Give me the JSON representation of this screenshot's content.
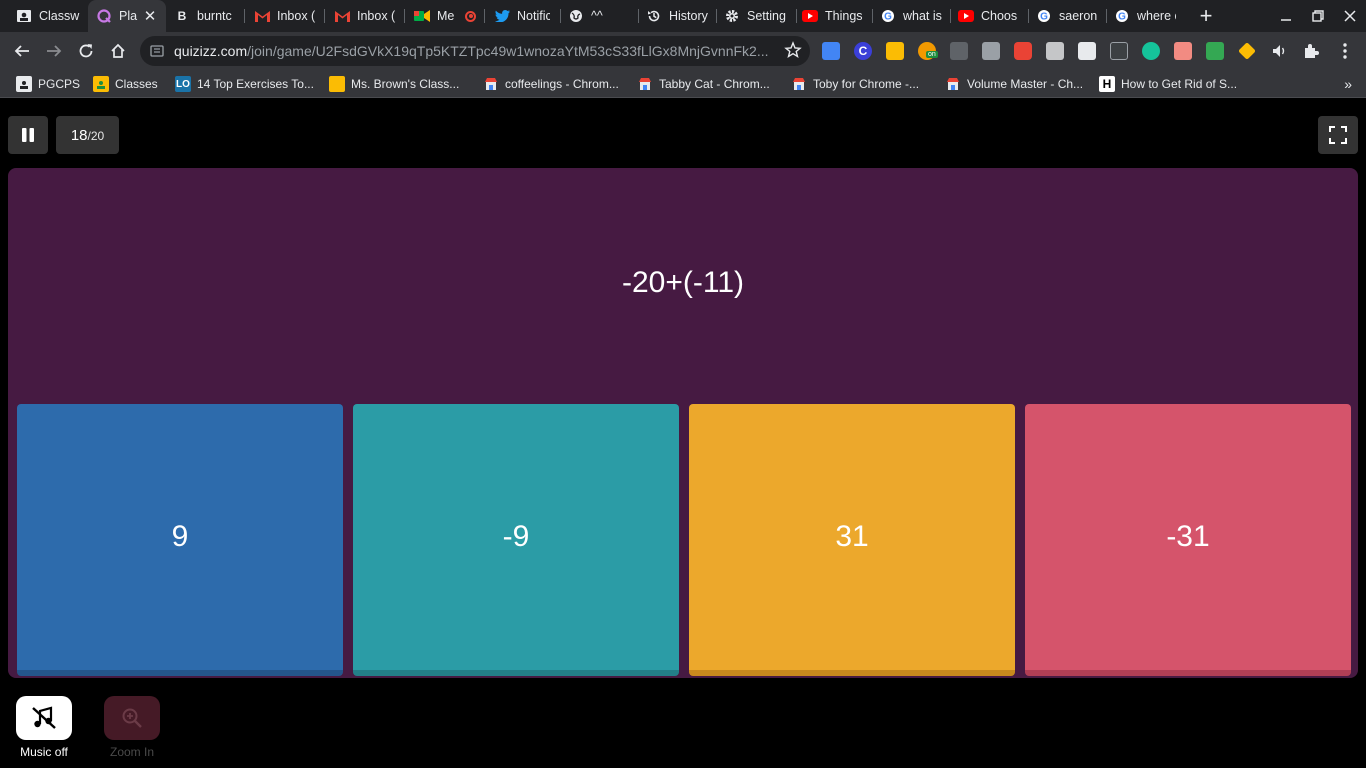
{
  "browser": {
    "tabs": [
      {
        "title": "Classw",
        "icon": "classroom-icon",
        "active": false
      },
      {
        "title": "Pla",
        "icon": "quizizz-icon",
        "active": true
      },
      {
        "title": "burntc",
        "icon": "bold-b-icon",
        "active": false
      },
      {
        "title": "Inbox (",
        "icon": "gmail-icon",
        "active": false
      },
      {
        "title": "Inbox (",
        "icon": "gmail-icon",
        "active": false
      },
      {
        "title": "Me",
        "icon": "meet-icon",
        "active": false
      },
      {
        "title": "Notific",
        "icon": "twitter-icon",
        "active": false
      },
      {
        "title": "^^",
        "icon": "globe-icon",
        "active": false
      },
      {
        "title": "History",
        "icon": "history-icon",
        "active": false
      },
      {
        "title": "Setting",
        "icon": "gear-icon",
        "active": false
      },
      {
        "title": "Things",
        "icon": "youtube-icon",
        "active": false
      },
      {
        "title": "what is",
        "icon": "google-icon",
        "active": false
      },
      {
        "title": "Choos",
        "icon": "youtube-icon",
        "active": false
      },
      {
        "title": "saeron",
        "icon": "google-icon",
        "active": false
      },
      {
        "title": "where c",
        "icon": "google-icon",
        "active": false
      }
    ],
    "url_host": "quizizz.com",
    "url_path": "/join/game/U2FsdGVkX19qTp5KTZTpc49w1wnozaYtM53cS33fLlGx8MnjGvnnFk2...",
    "bookmarks": [
      {
        "label": "PGCPS",
        "icon": "classroom-icon"
      },
      {
        "label": "Classes",
        "icon": "classroom-icon"
      },
      {
        "label": "14 Top Exercises To...",
        "icon": "lo-icon"
      },
      {
        "label": "Ms. Brown's Class...",
        "icon": "folder-icon"
      },
      {
        "label": "coffeelings - Chrom...",
        "icon": "store-icon"
      },
      {
        "label": "Tabby Cat - Chrom...",
        "icon": "store-icon"
      },
      {
        "label": "Toby for Chrome -...",
        "icon": "store-icon"
      },
      {
        "label": "Volume Master - Ch...",
        "icon": "store-icon"
      },
      {
        "label": "How to Get Rid of S...",
        "icon": "h-icon"
      }
    ]
  },
  "quiz": {
    "current": "18",
    "total": "/20",
    "question": "-20+(-11)",
    "options": [
      "9",
      "-9",
      "31",
      "-31"
    ],
    "music_label": "Music off",
    "zoom_label": "Zoom In"
  },
  "colors": {
    "panel": "#461a42",
    "option_blue": "#2d6bac",
    "option_teal": "#2b9ca6",
    "option_yellow": "#eca82c",
    "option_red": "#d5546b"
  }
}
